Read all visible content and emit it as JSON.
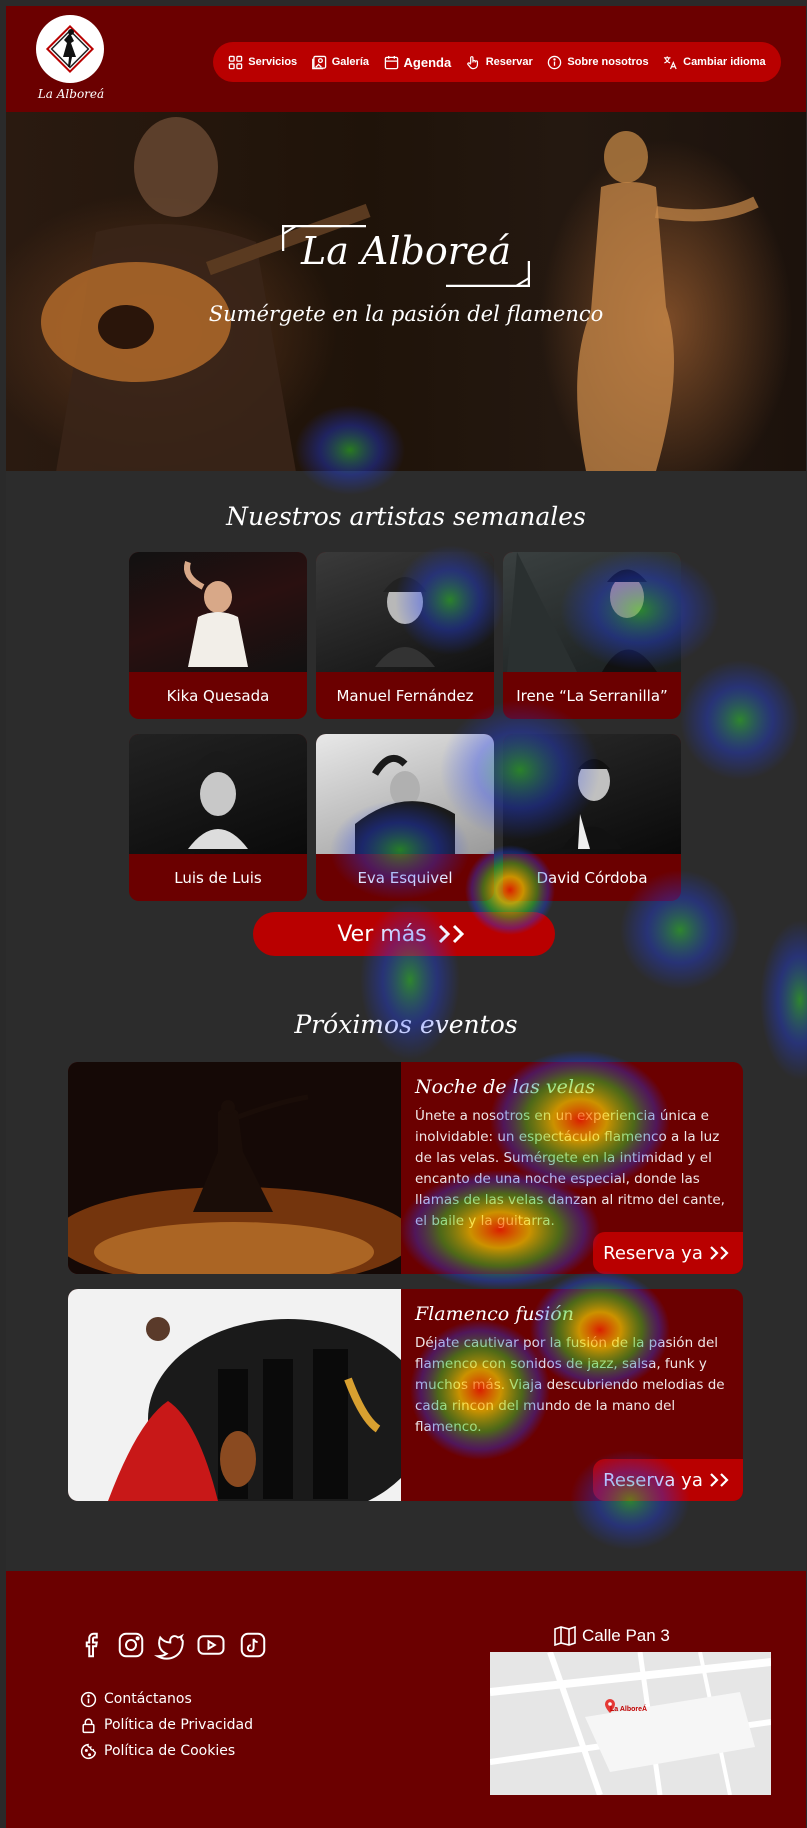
{
  "brand": {
    "name": "La Alboreá"
  },
  "nav": {
    "items": [
      {
        "label": "Servicios",
        "icon": "grid-icon"
      },
      {
        "label": "Galería",
        "icon": "gallery-icon"
      },
      {
        "label": "Agenda",
        "icon": "calendar-icon"
      },
      {
        "label": "Reservar",
        "icon": "hand-pointer-icon"
      },
      {
        "label": "Sobre nosotros",
        "icon": "info-icon"
      },
      {
        "label": "Cambiar idioma",
        "icon": "translate-icon"
      }
    ]
  },
  "hero": {
    "title": "La Alboreá",
    "subtitle": "Sumérgete en la pasión del flamenco"
  },
  "artists": {
    "title": "Nuestros artistas semanales",
    "items": [
      {
        "name": "Kika Quesada"
      },
      {
        "name": "Manuel Fernández"
      },
      {
        "name": "Irene “La Serranilla”"
      },
      {
        "name": "Luis de Luis"
      },
      {
        "name": "Eva Esquivel"
      },
      {
        "name": "David Córdoba"
      }
    ],
    "more_label": "Ver más"
  },
  "events": {
    "title": "Próximos eventos",
    "items": [
      {
        "title": "Noche de las velas",
        "description": "Únete a nosotros en un experiencia única e inolvidable: un espectáculo flamenco a la luz de las velas. Sumérgete en la intimidad y el encanto de una noche especial, donde las llamas de las velas danzan al ritmo del cante, el baile y la guitarra.",
        "button": "Reserva ya"
      },
      {
        "title": "Flamenco fusión",
        "description": "Déjate cautivar por la fusión de la pasión del flamenco con sonidos de jazz, salsa, funk y muchos más. Viaja descubriendo melodias de cada rincon del mundo de la mano del flamenco.",
        "button": "Reserva ya"
      }
    ]
  },
  "footer": {
    "socials": [
      "facebook-icon",
      "instagram-icon",
      "twitter-icon",
      "youtube-icon",
      "tiktok-icon"
    ],
    "links": [
      {
        "label": "Contáctanos",
        "icon": "info-icon"
      },
      {
        "label": "Política de Privacidad",
        "icon": "lock-icon"
      },
      {
        "label": "Política de Cookies",
        "icon": "cookie-icon"
      }
    ],
    "address": "Calle Pan 3",
    "map_label": "La AlboreÁ"
  },
  "colors": {
    "header": "#6b0000",
    "accent": "#b90000",
    "body": "#2c2c2c"
  }
}
